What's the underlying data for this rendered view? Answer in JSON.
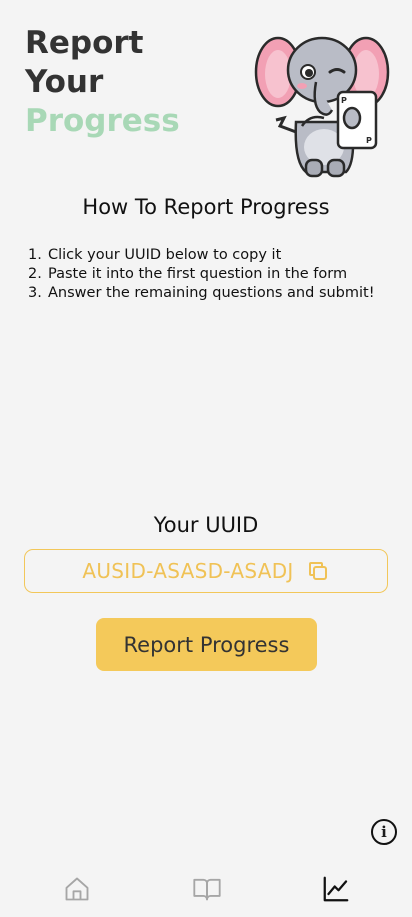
{
  "header": {
    "title_line1": "Report",
    "title_line2": "Your",
    "title_line3": "Progress",
    "mascot_icon": "elephant-holding-phone-illustration"
  },
  "instructions": {
    "title": "How To Report Progress",
    "steps": [
      {
        "num": "1.",
        "text": "Click your UUID below to copy it"
      },
      {
        "num": "2.",
        "text": "Paste it into the first question in the form"
      },
      {
        "num": "3.",
        "text": "Answer the remaining questions and submit!"
      }
    ]
  },
  "uuid": {
    "label": "Your UUID",
    "value": "AUSID-ASASD-ASADJ",
    "icon": "copy-icon"
  },
  "actions": {
    "report_label": "Report Progress",
    "info_label": "i"
  },
  "nav": {
    "items": [
      {
        "icon": "home-icon"
      },
      {
        "icon": "book-icon"
      },
      {
        "icon": "chart-icon"
      }
    ]
  },
  "colors": {
    "accent_yellow": "#f4c95a",
    "accent_green": "#a8d8b6",
    "background": "#f4f4f4"
  }
}
